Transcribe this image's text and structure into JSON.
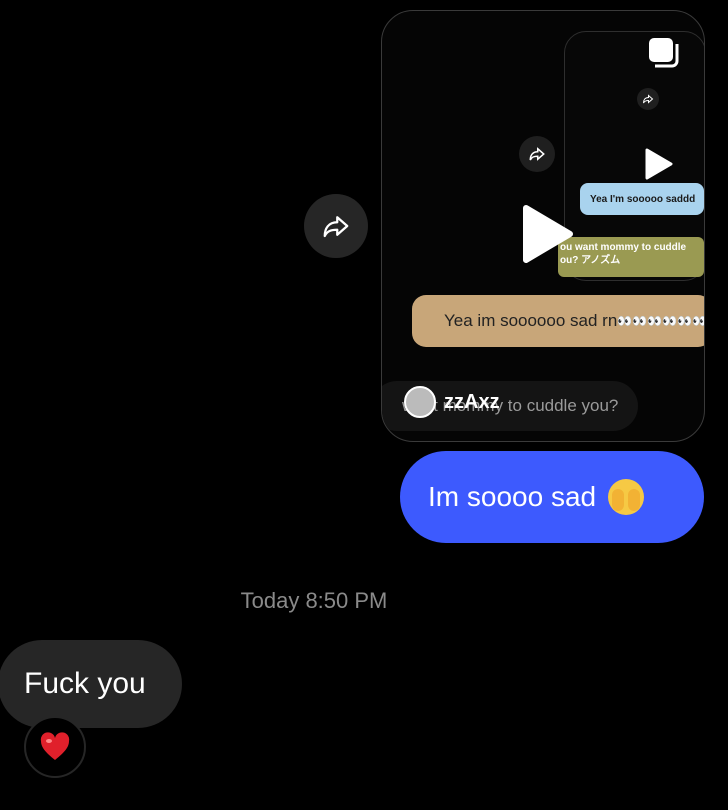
{
  "reel": {
    "inner_blue_text": "Yea I'm sooooo saddd",
    "inner_olive_line1": "ou want mommy to cuddle",
    "inner_olive_line2": "ou? アノズム",
    "brown_text": "Yea im soooooo sad rn",
    "brown_suffix": "👀👀👀👀👀👀",
    "username": "zzAxz",
    "caption": "want mommy to cuddle you?"
  },
  "messages": {
    "sent_text": "Im soooo sad",
    "timestamp": "Today 8:50 PM",
    "received_text": "Fuck you",
    "reaction": "❤️"
  },
  "colors": {
    "sent_bubble": "#3d5afe",
    "received_bubble": "#262626",
    "background": "#000000"
  },
  "icons": [
    "share-forward-icon",
    "play-icon",
    "multi-post-icon",
    "heart-reaction-icon"
  ]
}
